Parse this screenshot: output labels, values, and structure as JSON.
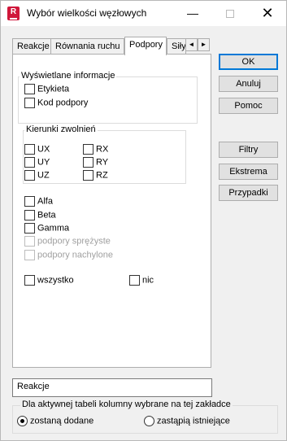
{
  "window": {
    "title": "Wybór wielkości węzłowych",
    "icon_letter": "R",
    "minimize_glyph": "—",
    "close_glyph": "✕"
  },
  "tabs": {
    "items": [
      "Reakcje",
      "Równania ruchu",
      "Podpory",
      "Siły"
    ],
    "active": "Podpory",
    "scroll_left": "◄",
    "scroll_right": "►"
  },
  "panel": {
    "displayed_info": {
      "title": "Wyświetlane informacje",
      "items": [
        {
          "label": "Etykieta",
          "checked": false
        },
        {
          "label": "Kod podpory",
          "checked": false
        }
      ]
    },
    "release_directions": {
      "title": "Kierunki zwolnień",
      "items": [
        {
          "label": "UX",
          "checked": false
        },
        {
          "label": "RX",
          "checked": false
        },
        {
          "label": "UY",
          "checked": false
        },
        {
          "label": "RY",
          "checked": false
        },
        {
          "label": "UZ",
          "checked": false
        },
        {
          "label": "RZ",
          "checked": false
        }
      ]
    },
    "angles": [
      {
        "label": "Alfa",
        "checked": false,
        "enabled": true
      },
      {
        "label": "Beta",
        "checked": false,
        "enabled": true
      },
      {
        "label": "Gamma",
        "checked": false,
        "enabled": true
      },
      {
        "label": "podpory sprężyste",
        "checked": false,
        "enabled": false
      },
      {
        "label": "podpory nachylone",
        "checked": false,
        "enabled": false
      }
    ],
    "all": {
      "label": "wszystko",
      "checked": false
    },
    "none": {
      "label": "nic",
      "checked": false
    }
  },
  "buttons": {
    "ok": "OK",
    "cancel": "Anuluj",
    "help": "Pomoc",
    "filters": "Filtry",
    "extremes": "Ekstrema",
    "cases": "Przypadki"
  },
  "table_name_field": {
    "value": "Reakcje"
  },
  "columns_group": {
    "title": "Dla aktywnej tabeli kolumny wybrane na tej zakładce",
    "options": [
      {
        "label": "zostaną dodane",
        "checked": true
      },
      {
        "label": "zastąpią istniejące",
        "checked": false
      }
    ]
  },
  "colors": {
    "accent": "#0078d7",
    "app_icon": "#d0173a",
    "dialog_background": "#f0f0f0"
  }
}
